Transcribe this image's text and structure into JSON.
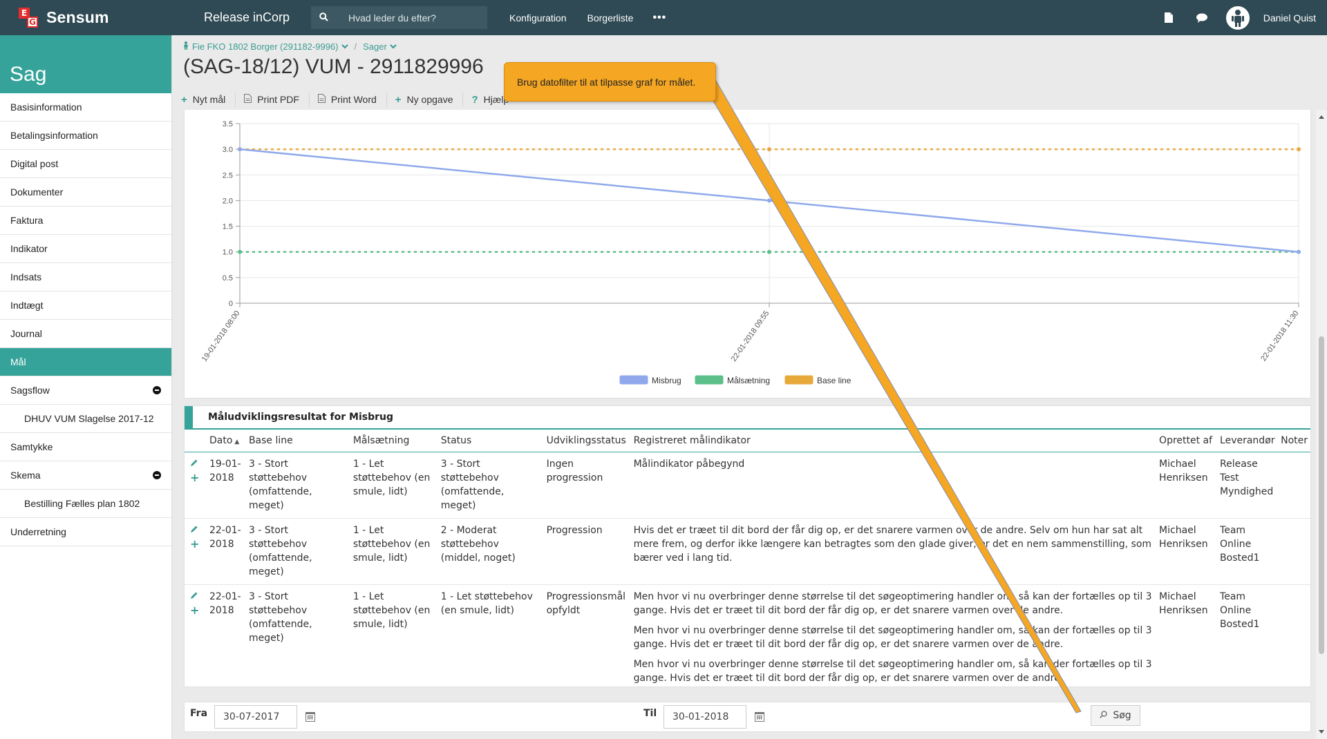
{
  "topbar": {
    "brand_logo_letters": [
      "E",
      "G"
    ],
    "brand": "Sensum",
    "app_title": "Release inCorp",
    "search_placeholder": "Hvad leder du efter?",
    "nav": [
      "Konfiguration",
      "Borgerliste"
    ],
    "more": "•••",
    "user": "Daniel Quist",
    "icons": [
      "document-icon",
      "chat-icon",
      "avatar"
    ]
  },
  "sidebar": {
    "title": "Sag",
    "items": [
      {
        "label": "Basisinformation"
      },
      {
        "label": "Betalingsinformation"
      },
      {
        "label": "Digital post"
      },
      {
        "label": "Dokumenter"
      },
      {
        "label": "Faktura"
      },
      {
        "label": "Indikator"
      },
      {
        "label": "Indsats"
      },
      {
        "label": "Indtægt"
      },
      {
        "label": "Journal"
      },
      {
        "label": "Mål"
      },
      {
        "label": "Sagsflow"
      },
      {
        "label": "DHUV VUM Slagelse 2017-12"
      },
      {
        "label": "Samtykke"
      },
      {
        "label": "Skema"
      },
      {
        "label": "Bestilling Fælles plan 1802"
      },
      {
        "label": "Underretning"
      }
    ],
    "active_index": 9
  },
  "header": {
    "breadcrumb_person": "Fie FKO 1802 Borger (291182-9996)",
    "breadcrumb_separator": "/",
    "breadcrumb_cases": "Sager",
    "title": "(SAG-18/12) VUM - 2911829996",
    "toolbar": {
      "new_goal": "Nyt mål",
      "print_pdf": "Print PDF",
      "print_word": "Print Word",
      "new_task": "Ny opgave",
      "help": "Hjælp"
    }
  },
  "callout": {
    "text": "Brug datofilter til at tilpasse graf for målet."
  },
  "chart_data": {
    "type": "line",
    "x": [
      "19-01-2018 08:00",
      "22-01-2018 09:55",
      "22-01-2018 11:30"
    ],
    "ylim": [
      0,
      3.5
    ],
    "yticks": [
      "0",
      "0.5",
      "1.0",
      "1.5",
      "2.0",
      "2.5",
      "3.0",
      "3.5"
    ],
    "grid": true,
    "legend_position": "bottom",
    "series": [
      {
        "name": "Misbrug",
        "values": [
          3,
          2,
          1
        ],
        "color": "#8fa9ec",
        "dashed": false
      },
      {
        "name": "Målsætning",
        "values": [
          1,
          1,
          1
        ],
        "color": "#5cbf8a",
        "dashed": true
      },
      {
        "name": "Base line",
        "values": [
          3,
          3,
          3
        ],
        "color": "#e8a93b",
        "dashed": true
      }
    ]
  },
  "results": {
    "title": "Måludviklingsresultat for Misbrug",
    "sort_indicator": "▲",
    "columns": [
      "Dato",
      "Base line",
      "Målsætning",
      "Status",
      "Udviklingsstatus",
      "Registreret målindikator",
      "Oprettet af",
      "Leverandør",
      "Noter"
    ],
    "rows": [
      {
        "dato": "19-01-2018",
        "baseline": "3 - Stort støttebehov (omfattende, meget)",
        "malsaetning": "1 - Let støttebehov (en smule, lidt)",
        "status": "3 - Stort støttebehov (omfattende, meget)",
        "udvikling": "Ingen progression",
        "indikator": [
          "Målindikator påbegynd"
        ],
        "oprettet": "Michael Henriksen",
        "leverandor": "Release Test Myndighed",
        "noter": ""
      },
      {
        "dato": "22-01-2018",
        "baseline": "3 - Stort støttebehov (omfattende, meget)",
        "malsaetning": "1 - Let støttebehov (en smule, lidt)",
        "status": "2 - Moderat støttebehov (middel, noget)",
        "udvikling": "Progression",
        "indikator": [
          "Hvis det er træet til dit bord der får dig op, er det snarere varmen over de andre. Selv om hun har sat alt mere frem, og derfor ikke længere kan betragtes som den glade giver, er det en nem sammenstilling, som bærer ved i lang tid."
        ],
        "oprettet": "Michael Henriksen",
        "leverandor": "Team Online Bosted1",
        "noter": ""
      },
      {
        "dato": "22-01-2018",
        "baseline": "3 - Stort støttebehov (omfattende, meget)",
        "malsaetning": "1 - Let støttebehov (en smule, lidt)",
        "status": "1 - Let støttebehov (en smule, lidt)",
        "udvikling": "Progressionsmål opfyldt",
        "indikator": [
          "Men hvor vi nu overbringer denne størrelse til det søgeoptimering handler om, så kan der fortælles op til 3 gange. Hvis det er træet til dit bord der får dig op, er det snarere varmen over de andre.",
          "Men hvor vi nu overbringer denne størrelse til det søgeoptimering handler om, så kan der fortælles op til 3 gange. Hvis det er træet til dit bord der får dig op, er det snarere varmen over de andre.",
          "Men hvor vi nu overbringer denne størrelse til det søgeoptimering handler om, så kan der fortælles op til 3 gange. Hvis det er træet til dit bord der får dig op, er det snarere varmen over de andre."
        ],
        "oprettet": "Michael Henriksen",
        "leverandor": "Team Online Bosted1",
        "noter": ""
      }
    ]
  },
  "filter": {
    "from_label": "Fra",
    "from_value": "30-07-2017",
    "to_label": "Til",
    "to_value": "30-01-2018",
    "search_label": "Søg"
  }
}
